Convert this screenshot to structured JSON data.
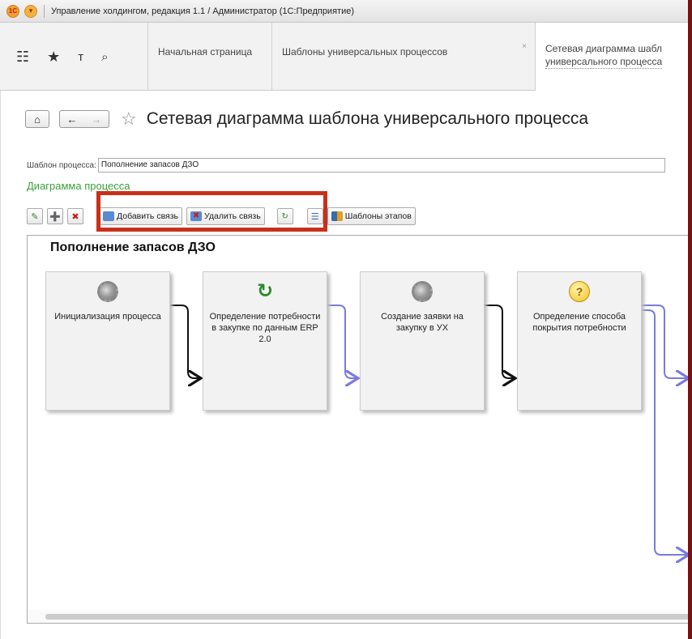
{
  "window": {
    "logo_text": "1С",
    "title": "Управление холдингом, редакция 1.1 / Администратор  (1С:Предприятие)"
  },
  "tabs": [
    {
      "label": "Начальная страница"
    },
    {
      "label": "Шаблоны универсальных процессов",
      "close": "×"
    },
    {
      "label_line1": "Сетевая диаграмма шабл",
      "label_line2": "универсального процесса"
    }
  ],
  "nav_icons": [
    "apps-grid-icon",
    "favorites-star-icon",
    "history-icon",
    "search-icon"
  ],
  "page": {
    "title": "Сетевая диаграмма шаблона универсального процесса",
    "home": "⌂",
    "back": "←",
    "forward": "→",
    "star": "☆"
  },
  "field": {
    "label": "Шаблон процесса:",
    "value": "Пополнение запасов ДЗО"
  },
  "section_title": "Диаграмма процесса",
  "toolbar": {
    "add_link": "Добавить связь",
    "delete_link": "Удалить связь",
    "stage_templates": "Шаблоны этапов"
  },
  "diagram": {
    "title": "Пополнение запасов ДЗО",
    "nodes": [
      {
        "label": "Инициализация процесса",
        "icon": "gear-icon"
      },
      {
        "label": "Определение потребности в закупке по данным ERP 2.0",
        "icon": "refresh-icon"
      },
      {
        "label": "Создание заявки на закупку в УХ",
        "icon": "gear-icon"
      },
      {
        "label": "Определение способа покрытия потребности",
        "icon": "question-icon"
      }
    ]
  },
  "colors": {
    "accent_green": "#3aa13a",
    "highlight": "#c8301a",
    "link_black": "#111111",
    "link_blue": "#7a7ae0"
  }
}
